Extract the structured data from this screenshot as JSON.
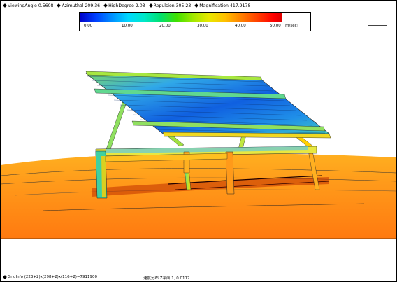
{
  "header": {
    "viewing_angle": "ViewingAngle  0.5608",
    "azimuthal": "Azimuthal 209.36",
    "high_degree": "HighDegree 2.03",
    "repulsion": "Repulsion 305.23",
    "magnification": "Magnification 417.9178"
  },
  "colorbar": {
    "labels": [
      "0.00",
      "10.00",
      "20.00",
      "30.00",
      "40.00",
      "50.00"
    ],
    "unit": "[m/sec]",
    "low_color": "#0000c8",
    "high_color": "#e00000"
  },
  "footer": {
    "grid_info": "GridInfo   (223+2)x(298+2)x(116+2)=7911900",
    "distribution": "速度分布  Z平面  1,  0.0117"
  },
  "scene": {
    "ground_color": "#ff8c1a",
    "panel_color": "#1a78e0",
    "frame_color": "#58d860"
  }
}
